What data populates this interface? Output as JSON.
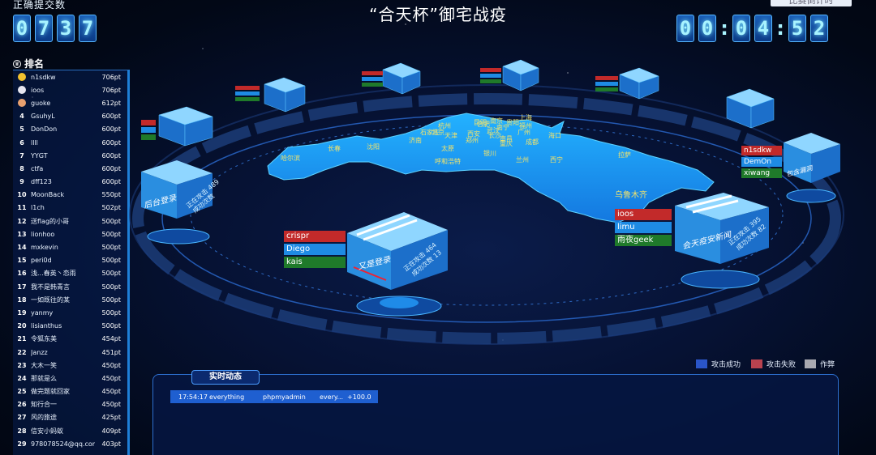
{
  "header": {
    "counter_label": "正确提交数",
    "counter_digits": [
      "0",
      "7",
      "3",
      "7"
    ],
    "title": "“合天杯”御宅战疫",
    "timer_label": "比赛倒计时",
    "timer_digits": [
      "0",
      "0",
      "0",
      "4",
      "5",
      "2"
    ],
    "timer_separator": ":"
  },
  "ranking": {
    "heading": "排名",
    "rows": [
      {
        "rank": "1",
        "name": "n1sdkw",
        "points": "706pt",
        "medal": "#f2c12e"
      },
      {
        "rank": "2",
        "name": "ioos",
        "points": "706pt",
        "medal": "#e6e6f0"
      },
      {
        "rank": "3",
        "name": "guoke",
        "points": "612pt",
        "medal": "#e8a16f"
      },
      {
        "rank": "4",
        "name": "GsuhyL",
        "points": "600pt"
      },
      {
        "rank": "5",
        "name": "DonDon",
        "points": "600pt"
      },
      {
        "rank": "6",
        "name": "llll",
        "points": "600pt"
      },
      {
        "rank": "7",
        "name": "YYGT",
        "points": "600pt"
      },
      {
        "rank": "8",
        "name": "ctfa",
        "points": "600pt"
      },
      {
        "rank": "9",
        "name": "dff123",
        "points": "600pt"
      },
      {
        "rank": "10",
        "name": "MoonBack",
        "points": "550pt"
      },
      {
        "rank": "11",
        "name": "l1ch",
        "points": "502pt"
      },
      {
        "rank": "12",
        "name": "送flag的小哥",
        "points": "500pt"
      },
      {
        "rank": "13",
        "name": "lionhoo",
        "points": "500pt"
      },
      {
        "rank": "14",
        "name": "mxkevin",
        "points": "500pt"
      },
      {
        "rank": "15",
        "name": "peri0d",
        "points": "500pt"
      },
      {
        "rank": "16",
        "name": "浅...春英丶恋雨",
        "points": "500pt"
      },
      {
        "rank": "17",
        "name": "我不是韩青言",
        "points": "500pt"
      },
      {
        "rank": "18",
        "name": "一如既往的某",
        "points": "500pt"
      },
      {
        "rank": "19",
        "name": "yanmy",
        "points": "500pt"
      },
      {
        "rank": "20",
        "name": "lisianthus",
        "points": "500pt"
      },
      {
        "rank": "21",
        "name": "令狐东美",
        "points": "454pt"
      },
      {
        "rank": "22",
        "name": "Janzz",
        "points": "451pt"
      },
      {
        "rank": "23",
        "name": "大木一笑",
        "points": "450pt"
      },
      {
        "rank": "24",
        "name": "那就是么",
        "points": "450pt"
      },
      {
        "rank": "25",
        "name": "做完题就回家",
        "points": "450pt"
      },
      {
        "rank": "26",
        "name": "知行合一",
        "points": "450pt"
      },
      {
        "rank": "27",
        "name": "风的旅途",
        "points": "425pt"
      },
      {
        "rank": "28",
        "name": "信安小蚂蚁",
        "points": "409pt"
      },
      {
        "rank": "29",
        "name": "978078524@qq.com",
        "points": "403pt"
      }
    ]
  },
  "map": {
    "cities": [
      "哈尔滨",
      "长春",
      "沈阳",
      "呼和浩特",
      "北京",
      "天津",
      "石家庄",
      "太原",
      "济南",
      "郑州",
      "西安",
      "银川",
      "兰州",
      "西宁",
      "拉萨",
      "乌鲁木齐",
      "合肥",
      "南京",
      "杭州",
      "上海",
      "武汉",
      "长沙",
      "南昌",
      "福州",
      "广州",
      "南宁",
      "昆明",
      "贵阳",
      "成都",
      "重庆",
      "海口"
    ]
  },
  "servers": {
    "main": {
      "label": "又是登录",
      "stat1": "正在攻击 464",
      "stat2": "成功次数 13",
      "teams": [
        "crispr",
        "Diego",
        "kais"
      ]
    },
    "right": {
      "label": "会天疫安新闻",
      "stat1": "正在攻击 395",
      "stat2": "成功次数 82",
      "teams": [
        "ioos",
        "limu",
        "雨夜geek"
      ]
    },
    "left": {
      "label": "后台登录",
      "stat1": "正在攻击 489",
      "stat2": "成功次数"
    },
    "far_right": {
      "label": "包含漏洞",
      "teams": [
        "n1sdkw",
        "DemOn",
        "xiwang"
      ]
    }
  },
  "legend": {
    "items": [
      {
        "label": "攻击成功",
        "color": "#2a55c8"
      },
      {
        "label": "攻击失败",
        "color": "#b8424f"
      },
      {
        "label": "作弊",
        "color": "#a9a9b0"
      }
    ]
  },
  "feed": {
    "title": "实时动态",
    "rows": [
      {
        "time": "17:54:17",
        "user": "everything",
        "target": "phpmyadmin",
        "detail": "every...",
        "delta": "+100.0"
      }
    ]
  }
}
